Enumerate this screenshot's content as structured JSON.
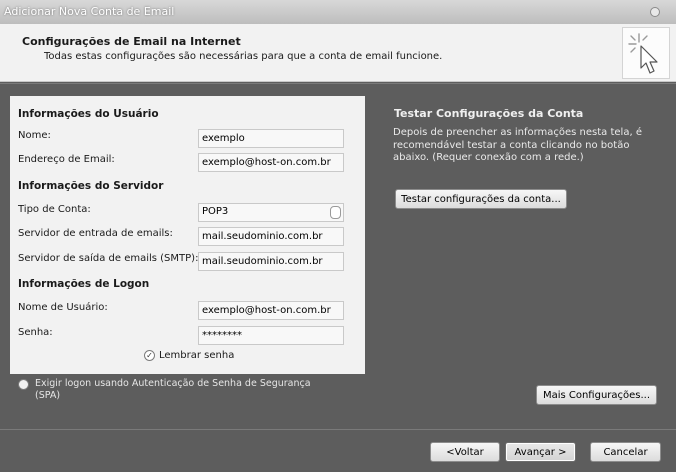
{
  "window": {
    "title": "Adicionar Nova Conta de Email"
  },
  "header": {
    "title": "Configurações de Email na Internet",
    "subtitle": "Todas estas configurações são necessárias para que a conta de email funcione."
  },
  "user_info": {
    "title": "Informações do Usuário",
    "name_label": "Nome:",
    "name_value": "exemplo",
    "email_label": "Endereço de Email:",
    "email_value": "exemplo@host-on.com.br"
  },
  "server_info": {
    "title": "Informações do Servidor",
    "account_type_label": "Tipo de Conta:",
    "account_type_value": "POP3",
    "incoming_label": "Servidor de entrada de emails:",
    "incoming_value": "mail.seudominio.com.br",
    "outgoing_label": "Servidor de saída de emails (SMTP):",
    "outgoing_value": "mail.seudominio.com.br"
  },
  "logon_info": {
    "title": "Informações de Logon",
    "username_label": "Nome de Usuário:",
    "username_value": "exemplo@host-on.com.br",
    "password_label": "Senha:",
    "password_value": "********",
    "remember_label": "Lembrar senha",
    "remember_checked": "✓"
  },
  "test": {
    "title": "Testar Configurações da Conta",
    "description": "Depois de preencher as informações nesta tela, é recomendável testar a conta clicando no botão abaixo. (Requer conexão com a rede.)",
    "button_label": "Testar configurações da conta..."
  },
  "spa": {
    "label": "Exigir logon usando Autenticação de Senha de Segurança (SPA)"
  },
  "buttons": {
    "more_settings": "Mais Configurações...",
    "back": "<Voltar",
    "next": "Avançar >",
    "cancel": "Cancelar"
  },
  "icons": {
    "header_icon": "cursor-click-icon",
    "close_icon": "close-icon"
  }
}
